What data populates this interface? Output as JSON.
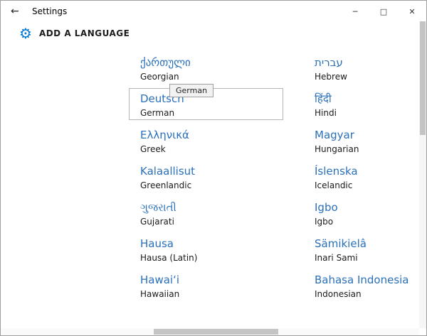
{
  "titlebar": {
    "back_icon": "←",
    "title": "Settings",
    "controls": {
      "minimize": "─",
      "maximize": "□",
      "close": "✕"
    }
  },
  "header": {
    "gear_icon": "⚙",
    "title": "ADD A LANGUAGE"
  },
  "tooltip": {
    "text": "German"
  },
  "languages": {
    "columns": [
      {
        "items": [
          {
            "native": "ქართული",
            "english": "Georgian"
          },
          {
            "native": "Deutsch",
            "english": "German",
            "state": "hovered"
          },
          {
            "native": "Ελληνικά",
            "english": "Greek"
          },
          {
            "native": "Kalaallisut",
            "english": "Greenlandic"
          },
          {
            "native": "ગુજરાતી",
            "english": "Gujarati"
          },
          {
            "native": "Hausa",
            "english": "Hausa (Latin)"
          },
          {
            "native": "Hawaiʻi",
            "english": "Hawaiian"
          }
        ]
      },
      {
        "items": [
          {
            "native": "עברית",
            "english": "Hebrew"
          },
          {
            "native": "हिंदी",
            "english": "Hindi"
          },
          {
            "native": "Magyar",
            "english": "Hungarian"
          },
          {
            "native": "Íslenska",
            "english": "Icelandic"
          },
          {
            "native": "Igbo",
            "english": "Igbo"
          },
          {
            "native": "Sämikielâ",
            "english": "Inari Sami"
          },
          {
            "native": "Bahasa Indonesia",
            "english": "Indonesian"
          }
        ]
      }
    ]
  },
  "colors": {
    "accent_blue": "#2a70ba",
    "gear_blue": "#0078d7",
    "hover_border": "#b5b5b5"
  }
}
